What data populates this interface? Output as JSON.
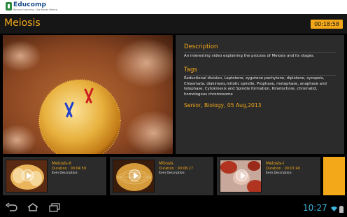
{
  "brand": {
    "name": "Educomp",
    "tagline": "Beyond Learning. Like Never Before."
  },
  "header": {
    "title": "Meiosis",
    "timer": "00:18:58"
  },
  "details": {
    "description_heading": "Description",
    "description": "An interesting video explaining the process of Meiosis and its stages.",
    "tags_heading": "Tags",
    "tags": "Reductional division, Leptotene, zygotene pachytene, diplotene, synapsis, Chiasmata, diakinesis,mitotic spindle, Prophase, metaphase, anaphase and telophase, Cytokinesis and Spindle formation, Kinetochore, chromatid, homologous chromosome",
    "meta": "Senior, Biology, 05 Aug,2013"
  },
  "related": [
    {
      "title": "Meiosis-II",
      "duration": "Duration : 00:04:59",
      "description_label": "Item Description:"
    },
    {
      "title": "Mitosis",
      "duration": "Duration : 00:06:17",
      "description_label": "Item Description:"
    },
    {
      "title": "Meiosis-I",
      "duration": "Duration : 00:07:40",
      "description_label": "Item Description:"
    }
  ],
  "statusbar": {
    "time": "10:27"
  },
  "colors": {
    "accent": "#f3a81a",
    "panel": "#2b2b2b",
    "clock": "#3fb6e0"
  },
  "icons": [
    "back-icon",
    "home-icon",
    "recent-apps-icon",
    "play-icon",
    "wifi-icon",
    "battery-icon"
  ]
}
